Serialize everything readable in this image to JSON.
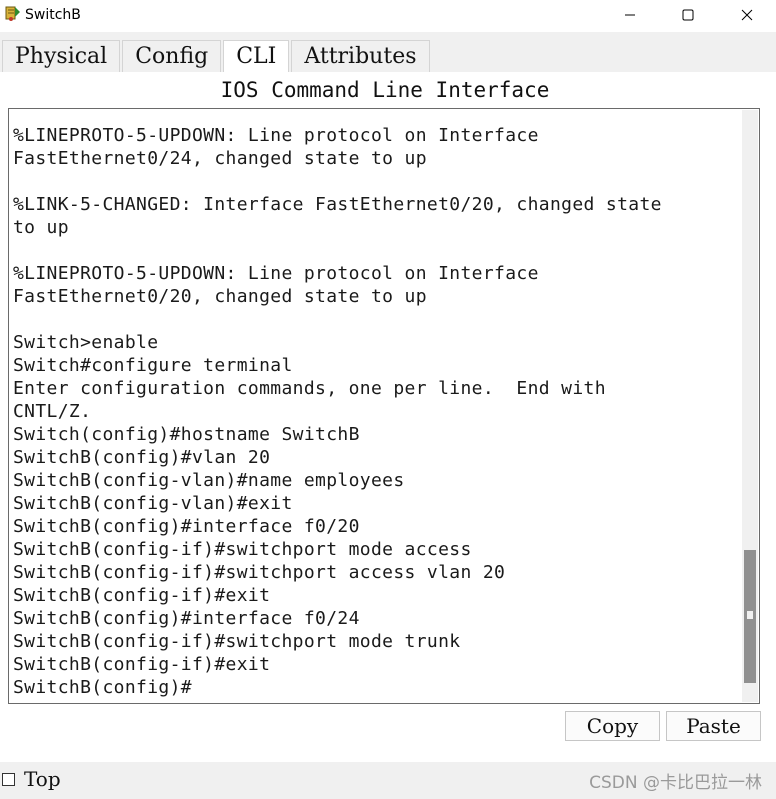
{
  "window": {
    "title": "SwitchB"
  },
  "tabs": [
    {
      "label": "Physical",
      "active": false
    },
    {
      "label": "Config",
      "active": false
    },
    {
      "label": "CLI",
      "active": true
    },
    {
      "label": "Attributes",
      "active": false
    }
  ],
  "panel": {
    "title": "IOS Command Line Interface"
  },
  "terminal": {
    "lines": [
      "%LINEPROTO-5-UPDOWN: Line protocol on Interface",
      "FastEthernet0/24, changed state to up",
      "",
      "%LINK-5-CHANGED: Interface FastEthernet0/20, changed state",
      "to up",
      "",
      "%LINEPROTO-5-UPDOWN: Line protocol on Interface",
      "FastEthernet0/20, changed state to up",
      "",
      "Switch>enable",
      "Switch#configure terminal",
      "Enter configuration commands, one per line.  End with",
      "CNTL/Z.",
      "Switch(config)#hostname SwitchB",
      "SwitchB(config)#vlan 20",
      "SwitchB(config-vlan)#name employees",
      "SwitchB(config-vlan)#exit",
      "SwitchB(config)#interface f0/20",
      "SwitchB(config-if)#switchport mode access",
      "SwitchB(config-if)#switchport access vlan 20",
      "SwitchB(config-if)#exit",
      "SwitchB(config)#interface f0/24",
      "SwitchB(config-if)#switchport mode trunk",
      "SwitchB(config-if)#exit",
      "SwitchB(config)#"
    ]
  },
  "buttons": {
    "copy": "Copy",
    "paste": "Paste"
  },
  "footer": {
    "top_label": "Top",
    "top_checked": false,
    "watermark": "CSDN @卡比巴拉一林"
  },
  "icons": {
    "app": "packet-tracer-device-icon",
    "minimize": "minimize-icon",
    "maximize": "maximize-icon",
    "close": "close-icon"
  }
}
